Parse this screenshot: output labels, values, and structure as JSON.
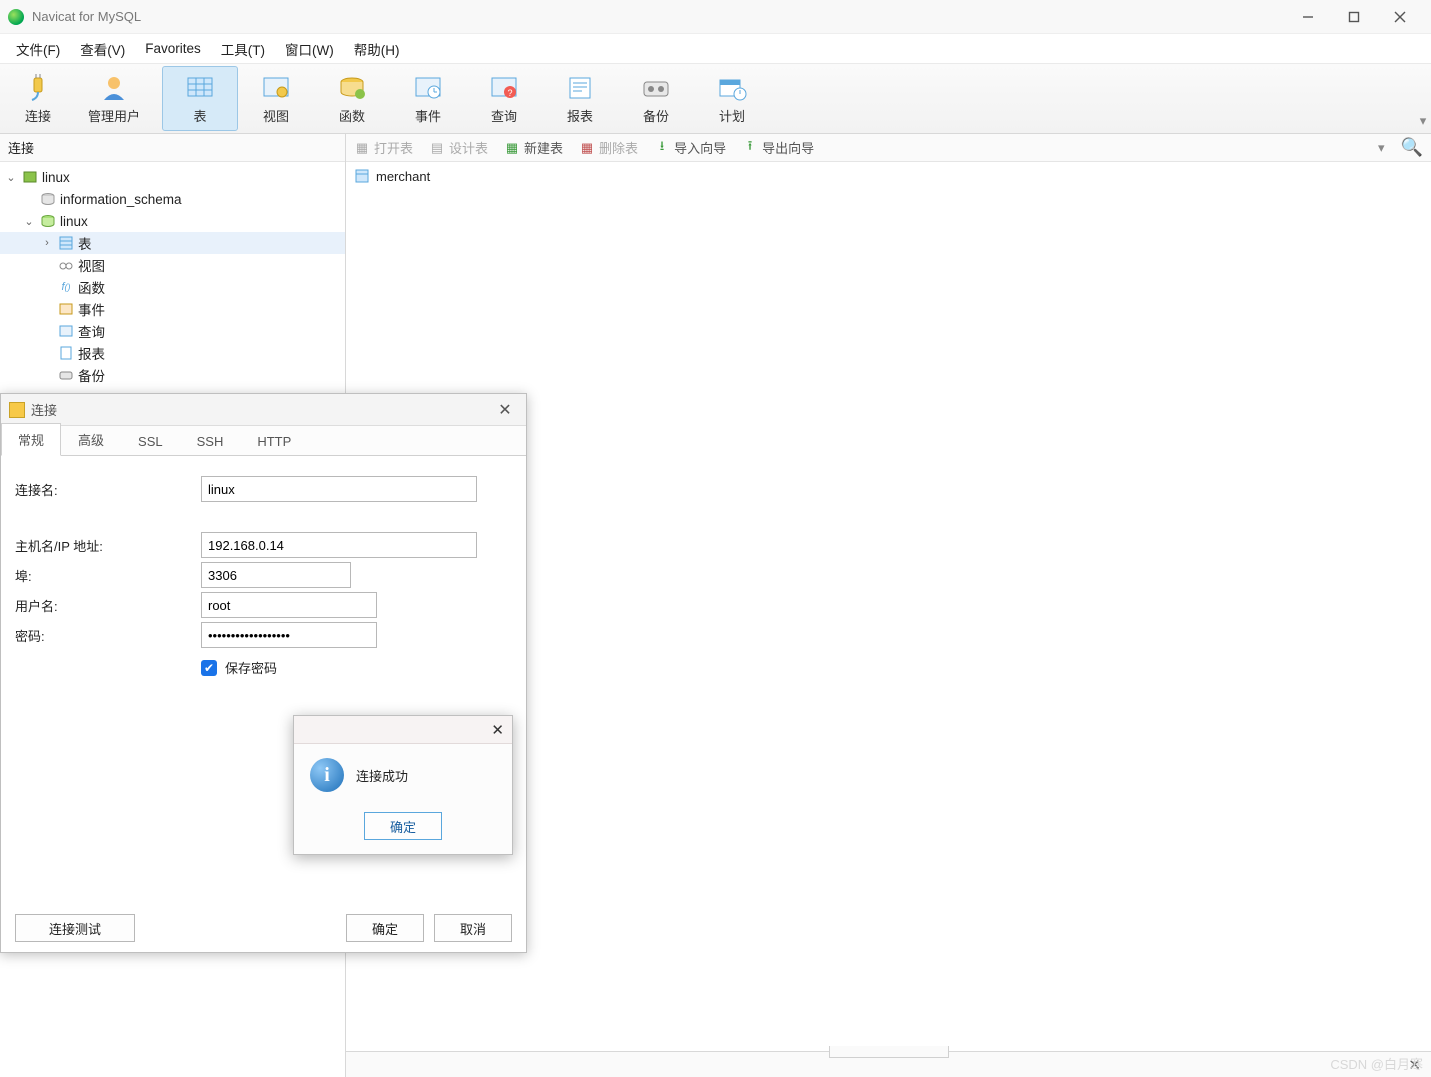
{
  "window": {
    "title": "Navicat for MySQL"
  },
  "menu": [
    "文件(F)",
    "查看(V)",
    "Favorites",
    "工具(T)",
    "窗口(W)",
    "帮助(H)"
  ],
  "toolbar": [
    {
      "id": "connect",
      "label": "连接"
    },
    {
      "id": "users",
      "label": "管理用户"
    },
    {
      "id": "table",
      "label": "表",
      "active": true
    },
    {
      "id": "view",
      "label": "视图"
    },
    {
      "id": "func",
      "label": "函数"
    },
    {
      "id": "event",
      "label": "事件"
    },
    {
      "id": "query",
      "label": "查询"
    },
    {
      "id": "report",
      "label": "报表"
    },
    {
      "id": "backup",
      "label": "备份"
    },
    {
      "id": "schedule",
      "label": "计划"
    }
  ],
  "sidebar": {
    "header": "连接",
    "tree": {
      "root": "linux",
      "info_schema": "information_schema",
      "db": "linux",
      "children": [
        "表",
        "视图",
        "函数",
        "事件",
        "查询",
        "报表",
        "备份"
      ]
    }
  },
  "subtoolbar": {
    "open": "打开表",
    "design": "设计表",
    "new": "新建表",
    "delete": "删除表",
    "import": "导入向导",
    "export": "导出向导"
  },
  "tablelist": [
    "merchant"
  ],
  "dialog": {
    "title": "连接",
    "tabs": [
      "常规",
      "高级",
      "SSL",
      "SSH",
      "HTTP"
    ],
    "active_tab": 0,
    "fields": {
      "name_label": "连接名:",
      "name_value": "linux",
      "host_label": "主机名/IP 地址:",
      "host_value": "192.168.0.14",
      "port_label": "埠:",
      "port_value": "3306",
      "user_label": "用户名:",
      "user_value": "root",
      "pass_label": "密码:",
      "pass_value": "••••••••••••••••••",
      "save_pass": "保存密码"
    },
    "buttons": {
      "test": "连接测试",
      "ok": "确定",
      "cancel": "取消"
    }
  },
  "msgbox": {
    "text": "连接成功",
    "ok": "确定"
  },
  "watermark": "CSDN @白月寒"
}
